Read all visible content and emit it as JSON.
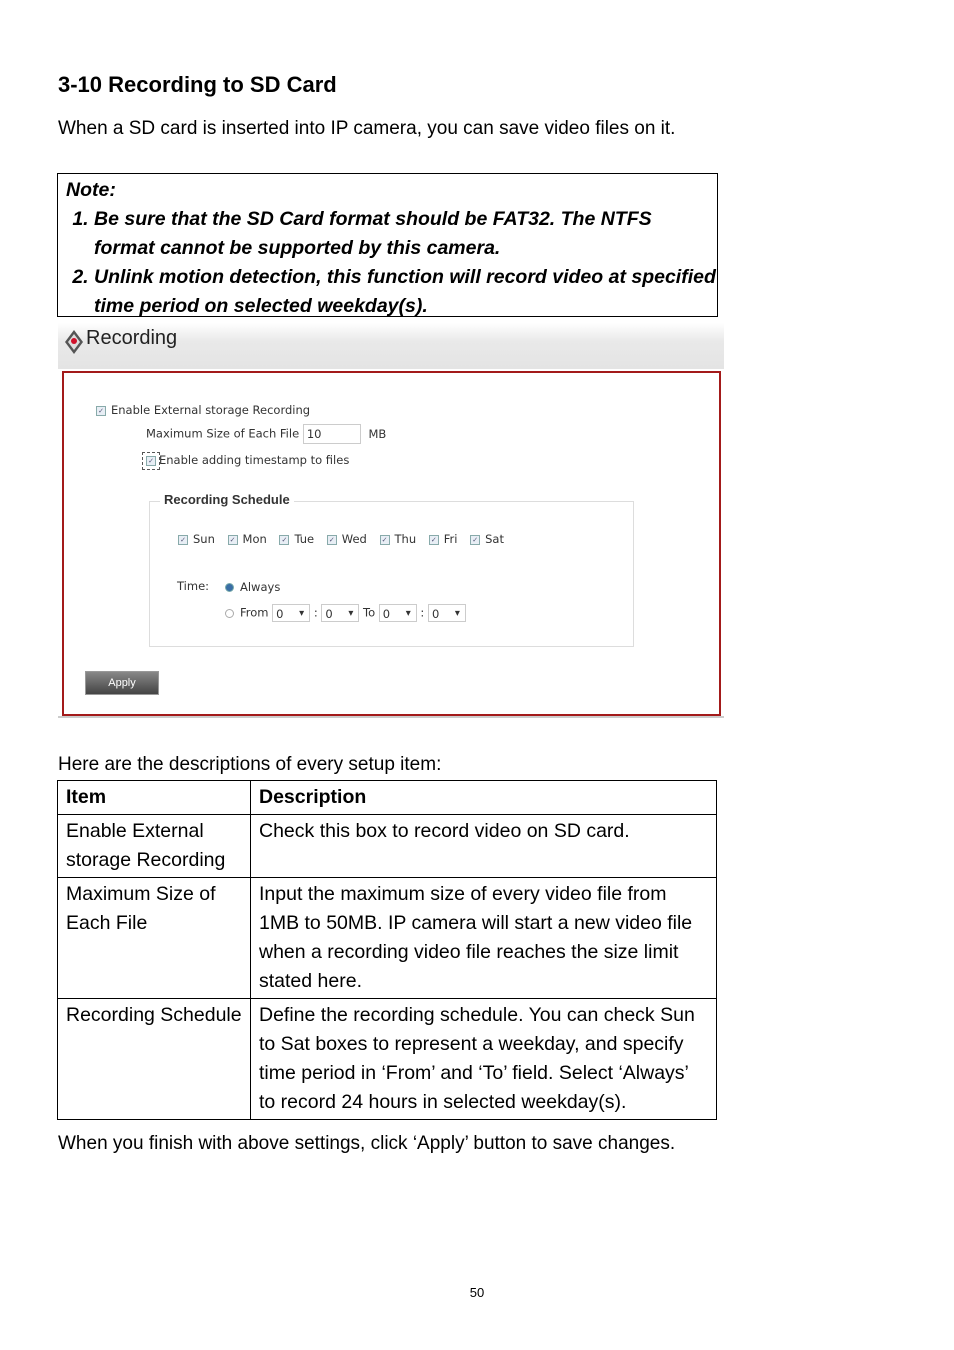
{
  "section_title": "3-10 Recording to SD Card",
  "intro": "When a SD card is inserted into IP camera, you can save video files on it.",
  "note": {
    "title": "Note:",
    "items": [
      "Be sure that the SD Card format should be FAT32.    The NTFS format cannot be supported by this camera.",
      "Unlink motion detection, this function will record video at specified time period on selected weekday(s)."
    ]
  },
  "screenshot": {
    "header_title": "Recording",
    "enable_recording_label": "Enable External storage Recording",
    "max_size_label": "Maximum Size of Each File",
    "max_size_value": "10",
    "max_size_unit": "MB",
    "timestamp_label": "Enable adding timestamp to files",
    "schedule_legend": "Recording Schedule",
    "days": [
      "Sun",
      "Mon",
      "Tue",
      "Wed",
      "Thu",
      "Fri",
      "Sat"
    ],
    "time_label": "Time:",
    "always_label": "Always",
    "from_label": "From",
    "to_label": "To",
    "from_hour": "0",
    "from_min": "0",
    "to_hour": "0",
    "to_min": "0",
    "colon": ":",
    "apply_label": "Apply"
  },
  "descriptions_intro": "Here are the descriptions of every setup item:",
  "table": {
    "headers": [
      "Item",
      "Description"
    ],
    "rows": [
      [
        "Enable External storage Recording",
        "Check this box to record video on SD card."
      ],
      [
        "Maximum Size of Each File",
        "Input the maximum size of every video file from 1MB to 50MB. IP camera will start a new video file when a recording video file reaches the size limit stated here."
      ],
      [
        "Recording Schedule",
        "Define the recording schedule. You can check Sun to Sat boxes to represent a weekday, and specify time period in ‘From’ and ‘To’ field. Select ‘Always’ to record 24 hours in selected weekday(s)."
      ]
    ]
  },
  "closing": "When you finish with above settings, click ‘Apply’ button to save changes.",
  "page_number": "50"
}
